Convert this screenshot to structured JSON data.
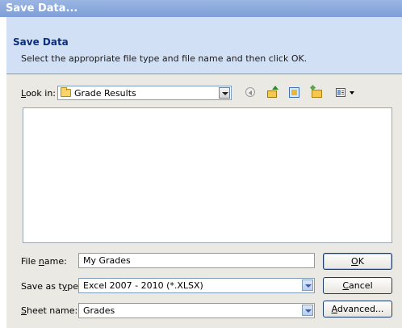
{
  "window": {
    "title": "Save Data..."
  },
  "header": {
    "title": "Save Data",
    "instruction": "Select the appropriate file type and file name and then click OK."
  },
  "lookin": {
    "label_pre": "",
    "label_key": "L",
    "label_post": "ook in:",
    "value": "Grade Results"
  },
  "toolbar": {
    "icons": [
      "back-icon",
      "up-folder-icon",
      "delete-icon",
      "new-folder-icon",
      "views-icon"
    ]
  },
  "file_name": {
    "label_pre": "File ",
    "label_key": "n",
    "label_post": "ame:",
    "value": "My Grades"
  },
  "save_as_type": {
    "label_pre": "Save as t",
    "label_key": "y",
    "label_post": "pe:",
    "value": "Excel 2007 - 2010 (*.XLSX)"
  },
  "sheet_name": {
    "label_pre": "",
    "label_key": "S",
    "label_post": "heet name:",
    "value": "Grades"
  },
  "buttons": {
    "ok": {
      "pre": "",
      "key": "O",
      "post": "K"
    },
    "cancel": {
      "pre": "",
      "key": "C",
      "post": "ancel"
    },
    "advanced": {
      "pre": "",
      "key": "A",
      "post": "dvanced..."
    }
  },
  "colors": {
    "title_bar": "#8eabdf",
    "header_band": "#d2e0f6",
    "dialog_body": "#ebe9e4",
    "header_title_text": "#0b2f7b"
  }
}
